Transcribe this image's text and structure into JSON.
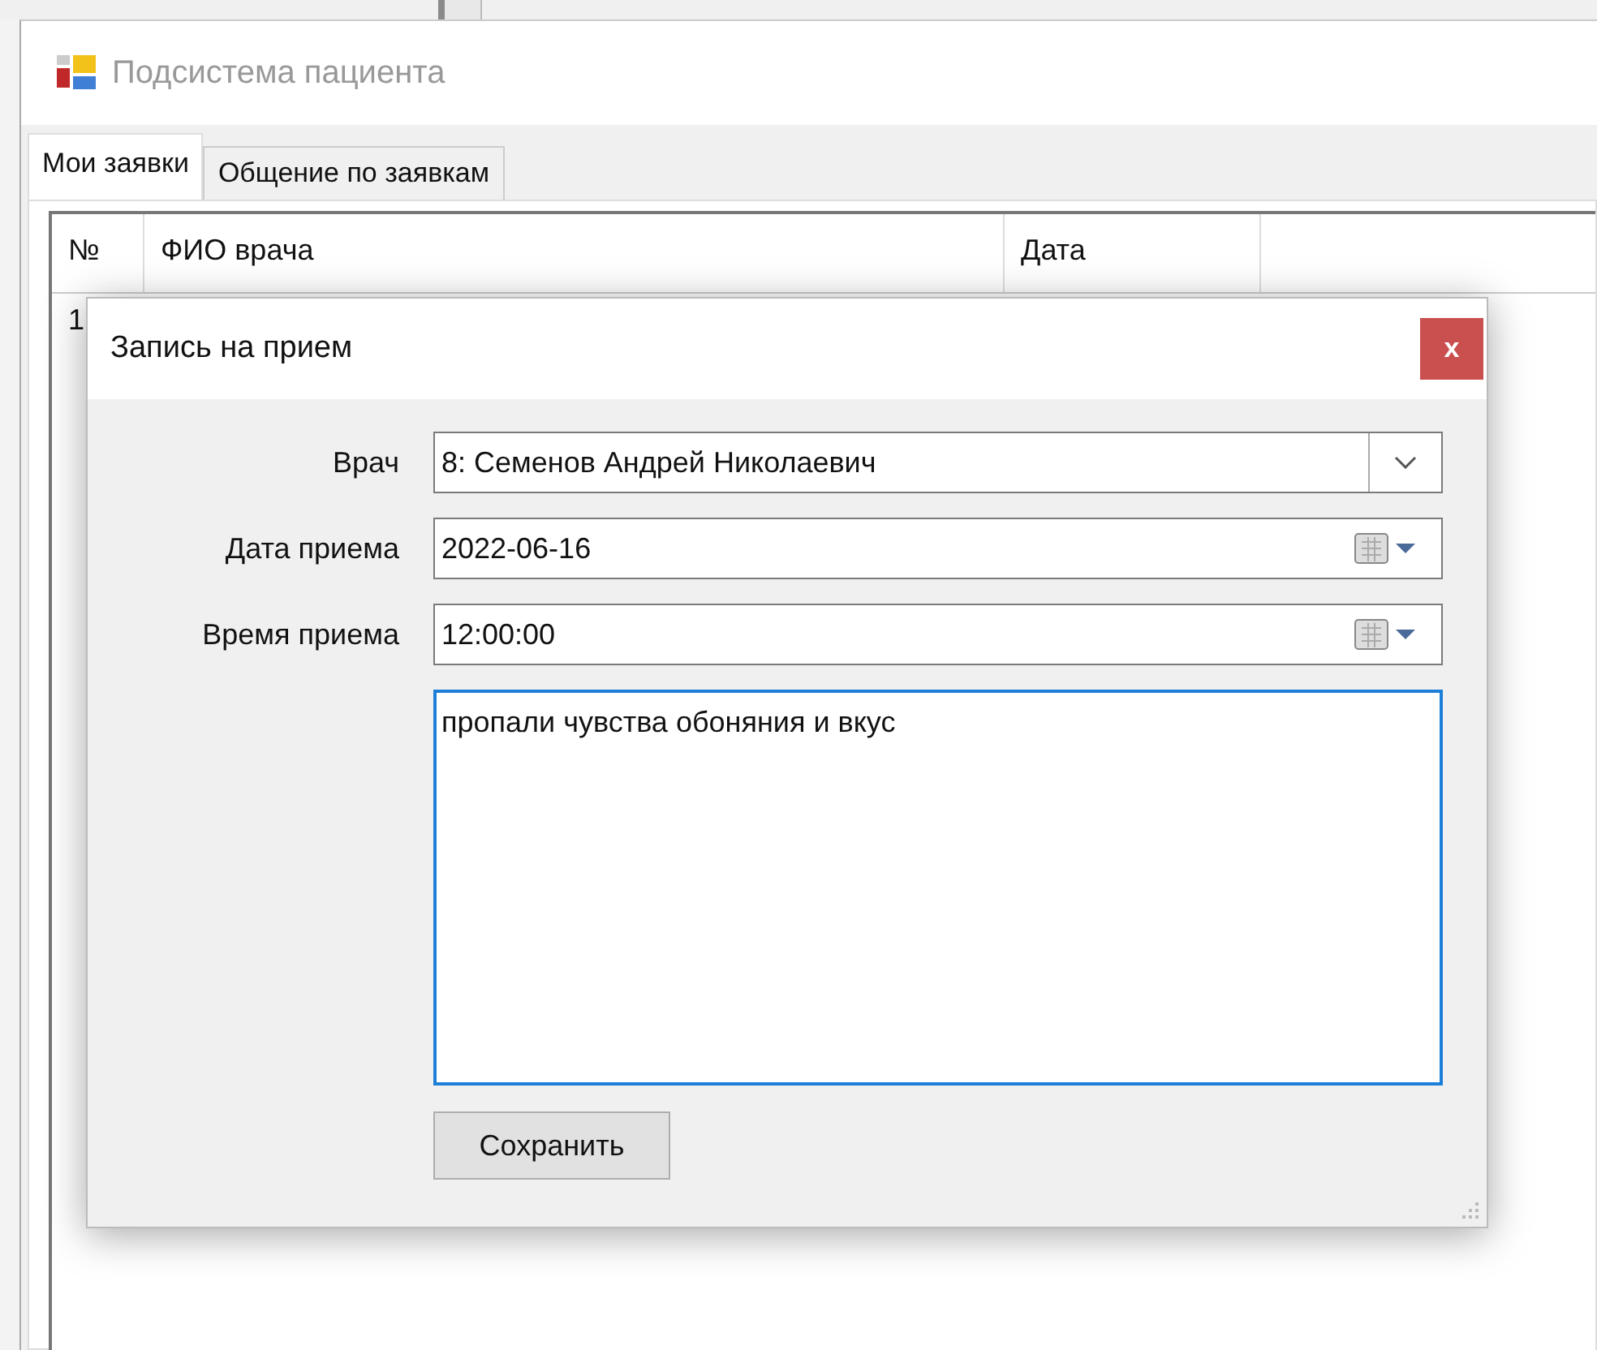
{
  "window": {
    "title": "Подсистема пациента"
  },
  "tabs": [
    {
      "label": "Мои заявки",
      "selected": true
    },
    {
      "label": "Общение по заявкам",
      "selected": false
    }
  ],
  "table": {
    "columns": [
      "№",
      "ФИО врача",
      "Дата"
    ],
    "rows": [
      [
        "1"
      ]
    ]
  },
  "dialog": {
    "title": "Запись на прием",
    "close": "x",
    "fields": [
      {
        "kind": "combo",
        "label": "Врач",
        "value": "8: Семенов Андрей  Николаевич"
      },
      {
        "kind": "date",
        "label": "Дата приема",
        "value": "2022-06-16"
      },
      {
        "kind": "date",
        "label": "Время приема",
        "value": "12:00:00"
      }
    ],
    "note": {
      "value": "пропали чувства обоняния и вкус",
      "focused": true
    },
    "save_button": "Сохранить"
  }
}
